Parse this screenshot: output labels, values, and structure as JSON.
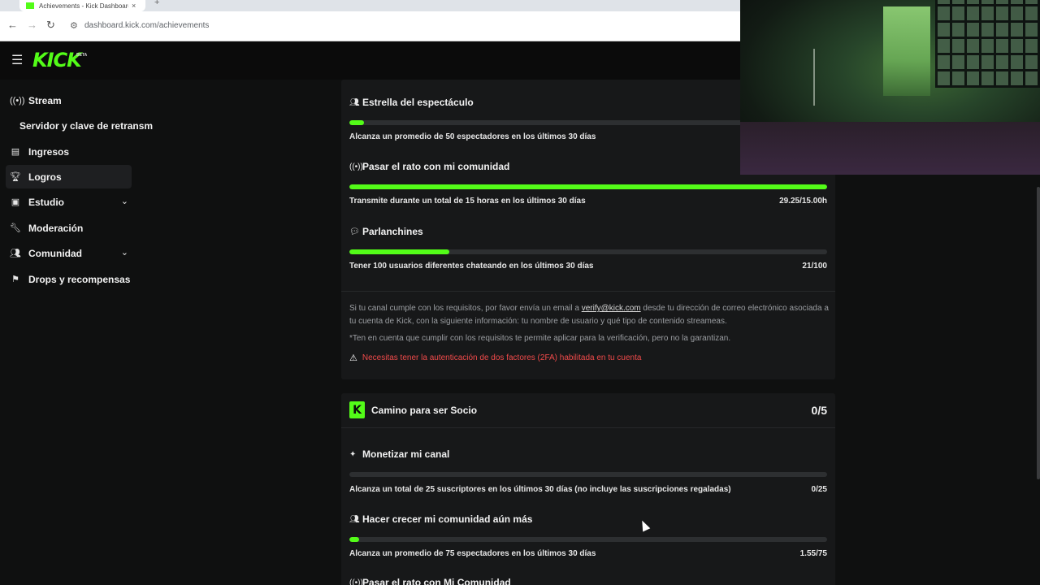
{
  "browser": {
    "tab_title": "Achievements - Kick Dashboard",
    "tab_close": "×",
    "new_tab": "+",
    "url": "dashboard.kick.com/achievements"
  },
  "header": {
    "logo": "KICK",
    "logo_badge": "BETA"
  },
  "sidebar": {
    "items": [
      {
        "label": "Stream",
        "icon": "broadcast-icon"
      },
      {
        "label": "Servidor y clave de retransm"
      },
      {
        "label": "Ingresos",
        "icon": "chart-icon"
      },
      {
        "label": "Logros",
        "icon": "trophy-icon",
        "active": true
      },
      {
        "label": "Estudio",
        "icon": "studio-icon",
        "expandable": true
      },
      {
        "label": "Moderación",
        "icon": "wrench-icon"
      },
      {
        "label": "Comunidad",
        "icon": "people-icon",
        "expandable": true
      },
      {
        "label": "Drops y recompensas",
        "icon": "gift-icon"
      }
    ]
  },
  "verification": {
    "achievements": [
      {
        "title": "Estrella del espectáculo",
        "description": "Alcanza un promedio de 50 espectadores en los últimos 30 días",
        "value": "",
        "progress": 0.03
      },
      {
        "title": "Pasar el rato con mi comunidad",
        "description": "Transmite durante un total de 15 horas en los últimos 30 días",
        "value": "29.25/15.00h",
        "progress": 1.0
      },
      {
        "title": "Parlanchines",
        "description": "Tener 100 usuarios diferentes chateando en los últimos 30 días",
        "value": "21/100",
        "progress": 0.21
      }
    ],
    "info_before_link": "Si tu canal cumple con los requisitos, por favor envía un email a ",
    "info_link": "verify@kick.com",
    "info_after_link": " desde tu dirección de correo electrónico asociada a tu cuenta de Kick, con la siguiente información: tu nombre de usuario y qué tipo de contenido streameas.",
    "disclaimer": "*Ten en cuenta que cumplir con los requisitos te permite aplicar para la verificación, pero no la garantizan.",
    "warning": "Necesitas tener la autenticación de dos factores (2FA) habilitada en tu cuenta"
  },
  "partner": {
    "badge": "K",
    "title": "Camino para ser Socio",
    "count": "0/5",
    "achievements": [
      {
        "title": "Monetizar mi canal",
        "description": "Alcanza un total de 25 suscriptores en los últimos 30 días (no incluye las suscripciones regaladas)",
        "value": "0/25",
        "progress": 0.0
      },
      {
        "title": "Hacer crecer mi comunidad aún más",
        "description": "Alcanza un promedio de 75 espectadores en los últimos 30 días",
        "value": "1.55/75",
        "progress": 0.02
      },
      {
        "title": "Pasar el rato con Mi Comunidad"
      }
    ]
  },
  "colors": {
    "accent": "#53fc18",
    "background": "#0f1010",
    "card": "#171819",
    "warning": "#f04a4a"
  }
}
